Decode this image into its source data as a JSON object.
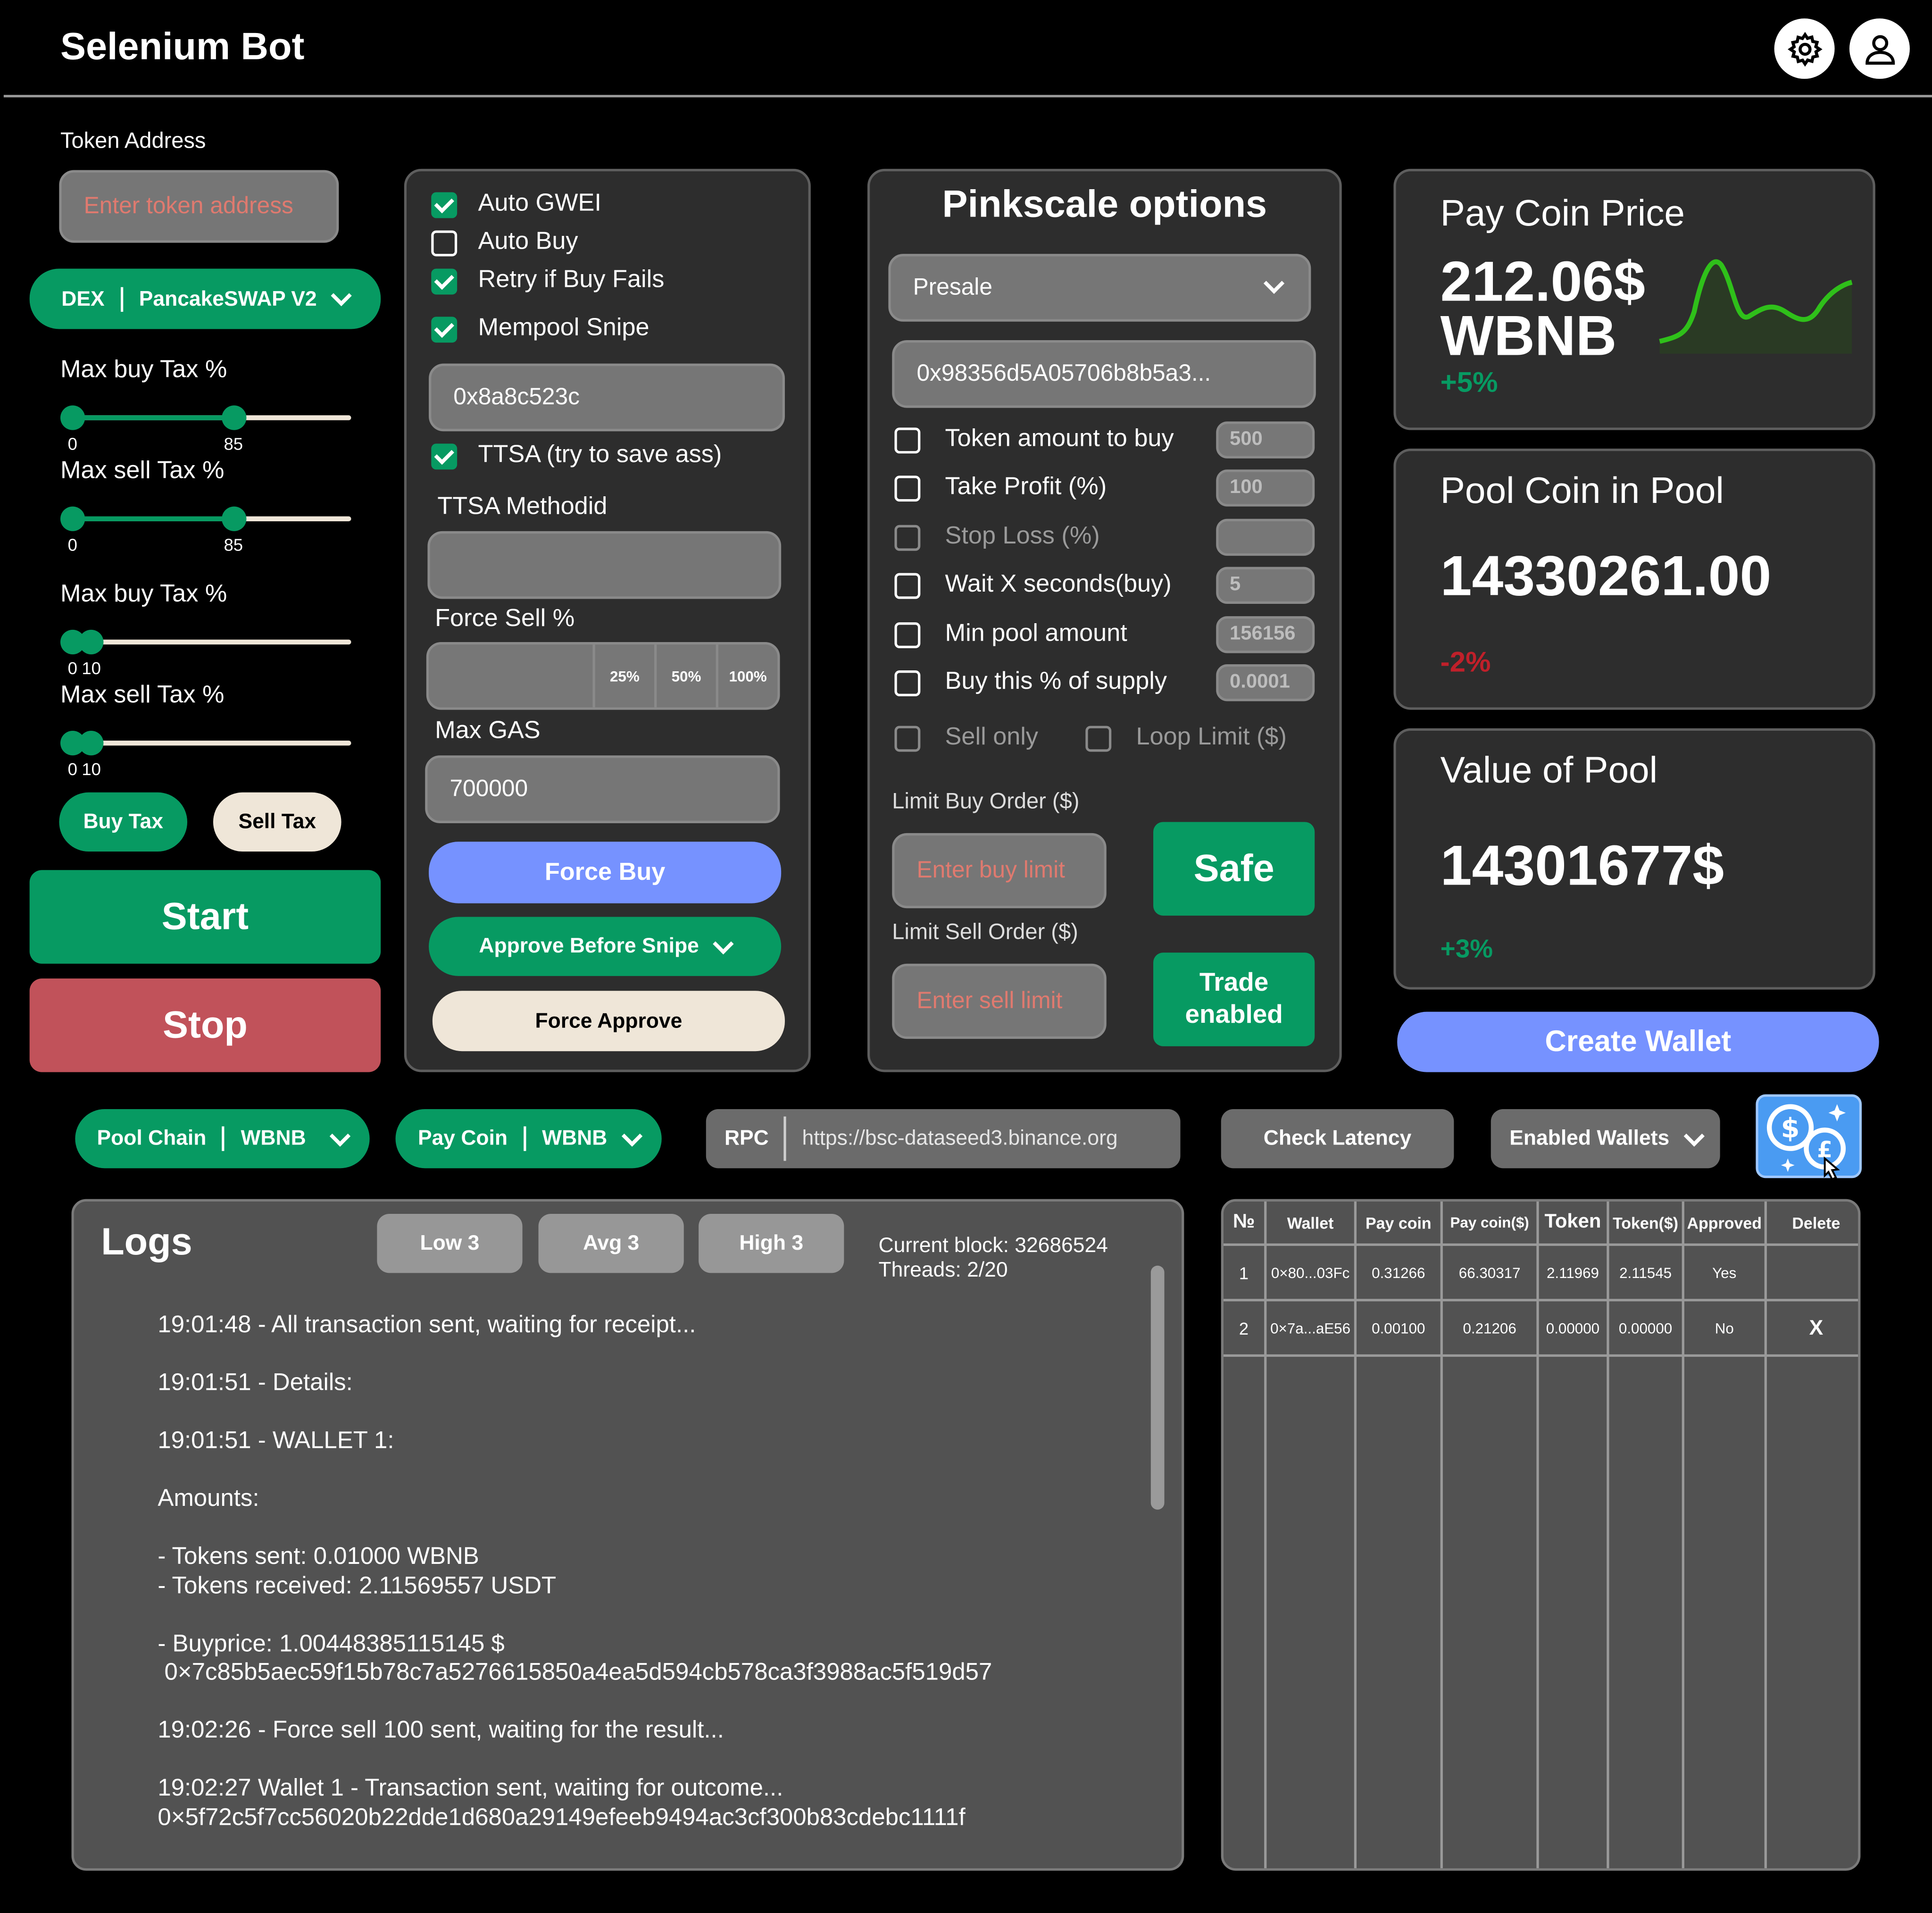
{
  "app": {
    "title": "Selenium Bot"
  },
  "header": {
    "settings_icon": "gear-icon",
    "profile_icon": "user-icon"
  },
  "left": {
    "token_label": "Token Address",
    "token_placeholder": "Enter token address",
    "dex_label": "DEX",
    "dex_value": "PancakeSWAP V2",
    "sliders": [
      {
        "label": "Max buy Tax %",
        "min_label": "0",
        "max_label": "85",
        "value": 85,
        "range": [
          0,
          100
        ]
      },
      {
        "label": "Max sell Tax %",
        "min_label": "0",
        "max_label": "85",
        "value": 85,
        "range": [
          0,
          100
        ]
      },
      {
        "label": "Max buy Tax %",
        "min_label": "0",
        "max_label": "10",
        "value": 10,
        "range": [
          0,
          100
        ]
      },
      {
        "label": "Max sell Tax %",
        "min_label": "0",
        "max_label": "10",
        "value": 10,
        "range": [
          0,
          100
        ]
      }
    ],
    "buy_tax": "Buy Tax",
    "sell_tax": "Sell Tax",
    "start": "Start",
    "stop": "Stop"
  },
  "options": {
    "auto_gwei": "Auto GWEI",
    "auto_gwei_checked": true,
    "auto_buy": "Auto Buy",
    "auto_buy_checked": false,
    "retry": "Retry if Buy Fails",
    "retry_checked": true,
    "mempool": "Mempool Snipe",
    "mempool_checked": true,
    "mempool_value": "0x8a8c523c",
    "ttsa": "TTSA (try to save ass)",
    "ttsa_checked": true,
    "ttsa_method_label": "TTSA Methodid",
    "ttsa_method_value": "",
    "force_sell_label": "Force Sell %",
    "force_sell_options": [
      "25%",
      "50%",
      "100%"
    ],
    "max_gas_label": "Max GAS",
    "max_gas_value": "700000",
    "force_buy": "Force Buy",
    "approve_before": "Approve Before Snipe",
    "force_approve": "Force Approve"
  },
  "pinkscale": {
    "title": "Pinkscale options",
    "select_value": "Presale",
    "address": "0x98356d5A05706b8b5a3...",
    "rows": [
      {
        "label": "Token amount to buy",
        "value": "500",
        "enabled": true
      },
      {
        "label": "Take Profit (%)",
        "value": "100",
        "enabled": true
      },
      {
        "label": "Stop Loss (%)",
        "value": "",
        "enabled": false
      },
      {
        "label": "Wait X seconds(buy)",
        "value": "5",
        "enabled": true
      },
      {
        "label": "Min pool amount",
        "value": "156156",
        "enabled": true
      },
      {
        "label": "Buy this % of supply",
        "value": "0.0001",
        "enabled": true
      }
    ],
    "sell_only": "Sell only",
    "loop_limit": "Loop Limit ($)",
    "limit_buy_label": "Limit Buy Order ($)",
    "limit_buy_placeholder": "Enter buy limit",
    "limit_sell_label": "Limit Sell Order ($)",
    "limit_sell_placeholder": "Enter  sell limit",
    "safe": "Safe",
    "trade_enabled": "Trade enabled"
  },
  "stats": {
    "pay_coin_title": "Pay Coin Price",
    "pay_coin_price": "212.06$",
    "pay_coin_unit": "WBNB",
    "pay_coin_change": "+5%",
    "pool_title": "Pool Coin in Pool",
    "pool_value": "14330261.00",
    "pool_change": "-2%",
    "value_title": "Value of Pool",
    "value_value": "14301677$",
    "value_change": "+3%",
    "create_wallet": "Create Wallet",
    "colors": {
      "up": "#079a62",
      "down": "#c0202a",
      "spark": "#2fc01a"
    }
  },
  "bar": {
    "pool_chain_label": "Pool Chain",
    "pool_chain_value": "WBNB",
    "pay_coin_label": "Pay Coin",
    "pay_coin_value": "WBNB",
    "rpc_label": "RPC",
    "rpc_value": "https://bsc-dataseed3.binance.org",
    "check_latency": "Check Latency",
    "enabled_wallets": "Enabled Wallets",
    "currency_icon": "currency-exchange-icon"
  },
  "logs": {
    "title": "Logs",
    "low": "Low 3",
    "avg": "Avg 3",
    "high": "High 3",
    "current_block": "Current block: 32686524",
    "threads": "Threads: 2/20",
    "lines": [
      "19:01:48 - All transaction sent, waiting for receipt...",
      "",
      "19:01:51 - Details:",
      "",
      "19:01:51 - WALLET 1:",
      "",
      "Amounts:",
      "",
      "- Tokens sent: 0.01000 WBNB",
      "- Tokens received: 2.11569557 USDT",
      "",
      "- Buyprice: 1.00448385115145 $",
      " 0×7c85b5aec59f15b78c7a5276615850a4ea5d594cb578ca3f3988ac5f519d57",
      "",
      "19:02:26 - Force sell 100 sent, waiting for the result...",
      "",
      "19:02:27 Wallet 1 - Transaction sent, waiting for outcome...",
      "0×5f72c5f7cc56020b22dde1d680a29149efeeb9494ac3cf300b83cdebc1111f"
    ]
  },
  "wallets": {
    "headers": [
      "№",
      "Wallet",
      "Pay coin",
      "Pay coin($)",
      "Token",
      "Token($)",
      "Approved",
      "Delete"
    ],
    "rows": [
      [
        "1",
        "0×80...03Fc",
        "0.31266",
        "66.30317",
        "2.11969",
        "2.11545",
        "Yes",
        ""
      ],
      [
        "2",
        "0×7a...aE56",
        "0.00100",
        "0.21206",
        "0.00000",
        "0.00000",
        "No",
        "X"
      ]
    ]
  }
}
